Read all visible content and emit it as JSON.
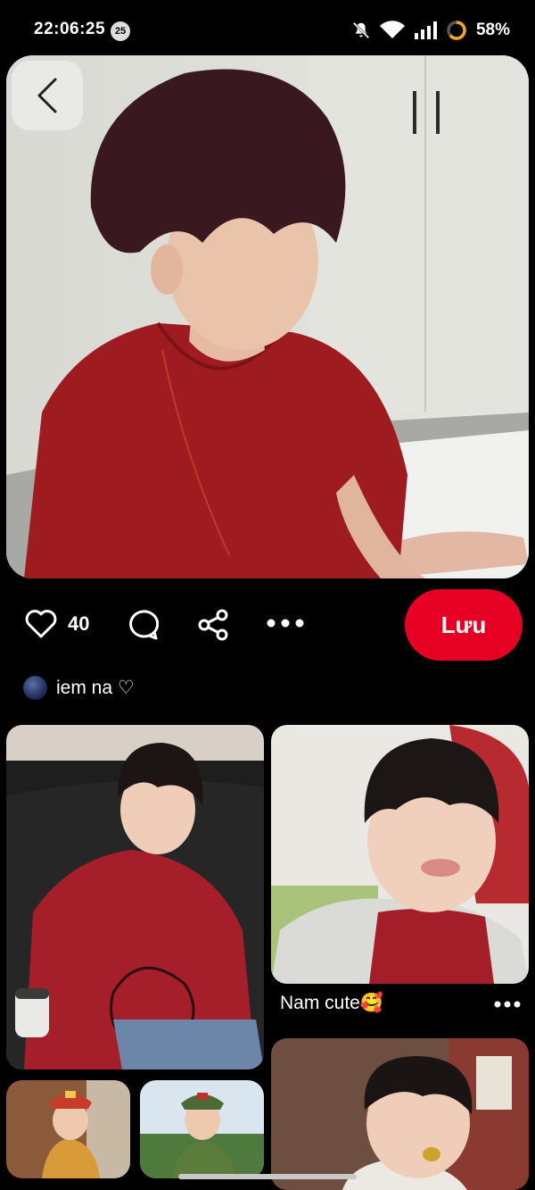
{
  "status_bar": {
    "time": "22:06:25",
    "notification_count": "25",
    "battery_percent": "58%"
  },
  "pin": {
    "like_count": "40",
    "save_label": "Lưu",
    "author_name": "iem na ♡"
  },
  "related": {
    "card2_caption": "Nam cute🥰"
  },
  "colors": {
    "save_button": "#e60023",
    "background": "#000000"
  },
  "icons": [
    "back-icon",
    "heart-icon",
    "comment-icon",
    "share-icon",
    "more-icon",
    "mute-icon",
    "wifi-icon",
    "signal-icon",
    "battery-icon"
  ]
}
